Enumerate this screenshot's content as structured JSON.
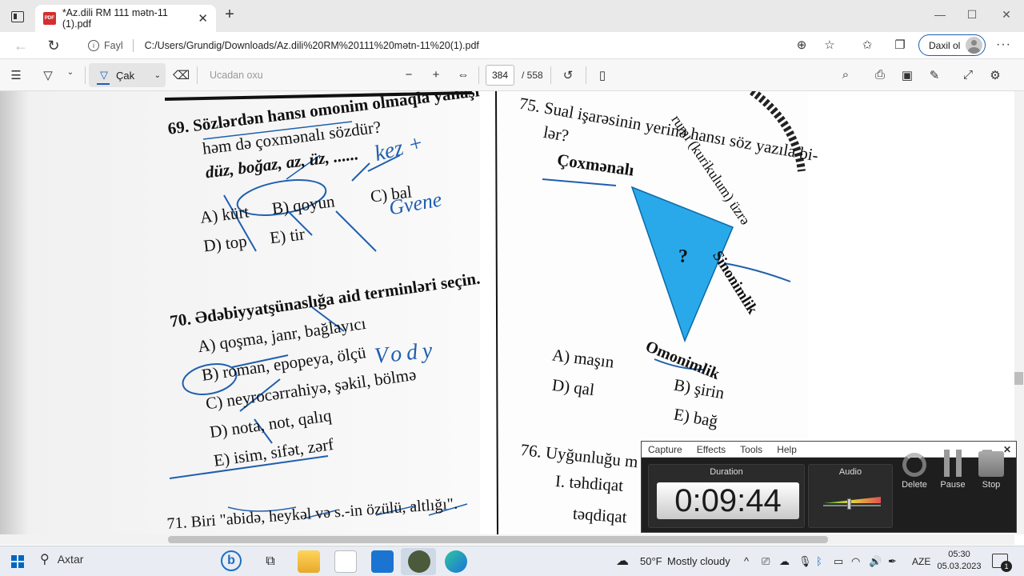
{
  "browser": {
    "tab_title": "*Az.dili RM 111 mətn-11 (1).pdf",
    "tab_close": "✕",
    "new_tab": "+",
    "site_info_label": "Fayl",
    "url": "C:/Users/Grundig/Downloads/Az.dili%20RM%20111%20mətn-11%20(1).pdf",
    "signin_label": "Daxil ol",
    "window_controls": [
      "—",
      "☐",
      "✕"
    ]
  },
  "pdf_toolbar": {
    "draw_label": "Çak",
    "read_aloud_label": "Ucadan oxu",
    "current_page": "384",
    "total_pages": "/ 558"
  },
  "document": {
    "q69_title": "69. Sözlərdən hansı omonim olmaqla yanaşı",
    "q69_title2": "həm də çoxmənalı sözdür?",
    "q69_words": "düz, boğaz, az, üz, ......",
    "q69_a": "A) kürt",
    "q69_b": "B) qoyun",
    "q69_c": "C) bal",
    "q69_d": "D) top",
    "q69_e": "E) tir",
    "q70_title": "70. Ədəbiyyatşünaslığa aid terminləri seçin.",
    "q70_a": "A) qoşma, janr, bağlayıcı",
    "q70_b": "B) roman, epopeya, ölçü",
    "q70_c": "C) neyrocərrahiyə, şəkil, bölmə",
    "q70_d": "D) nota, not, qalıq",
    "q70_e": "E) isim, sifət, zərf",
    "q71_partial": "71. Biri \"abidə, heykəl və s.-in özülü, altlığı\".",
    "q75_title": "75. Sual işarəsinin yerinə hansı söz yazıla bi-",
    "q75_title2": "lər?",
    "arc_text": "rumi (kurikulum) üzrə",
    "tri_top_left": "Çoxmənalı",
    "tri_right": "Sinonimlik",
    "tri_bottom": "Omonimlik",
    "tri_center": "?",
    "q75_a": "A) maşın",
    "q75_b": "B) şirin",
    "q75_d": "D) qal",
    "q75_e": "E) bağ",
    "q76_title": "76. Uyğunluğu m",
    "q76_i": "I.  təhdiqat",
    "q76_ii": "təqdiqat",
    "ink_notes": [
      "kez +",
      "Gvene",
      "Vody"
    ],
    "colors": {
      "triangle": "#2aa9ea",
      "ink": "#1f5fae"
    }
  },
  "recorder": {
    "menu": [
      "Capture",
      "Effects",
      "Tools",
      "Help"
    ],
    "duration_label": "Duration",
    "duration_value": "0:09:44",
    "audio_label": "Audio",
    "audio_level": 0.45,
    "delete_label": "Delete",
    "pause_label": "Pause",
    "stop_label": "Stop"
  },
  "taskbar": {
    "search_label": "Axtar",
    "weather_temp": "50°F",
    "weather_text": "Mostly cloudy",
    "language": "AZE",
    "time": "05:30",
    "date": "05.03.2023",
    "notifications": "1"
  }
}
